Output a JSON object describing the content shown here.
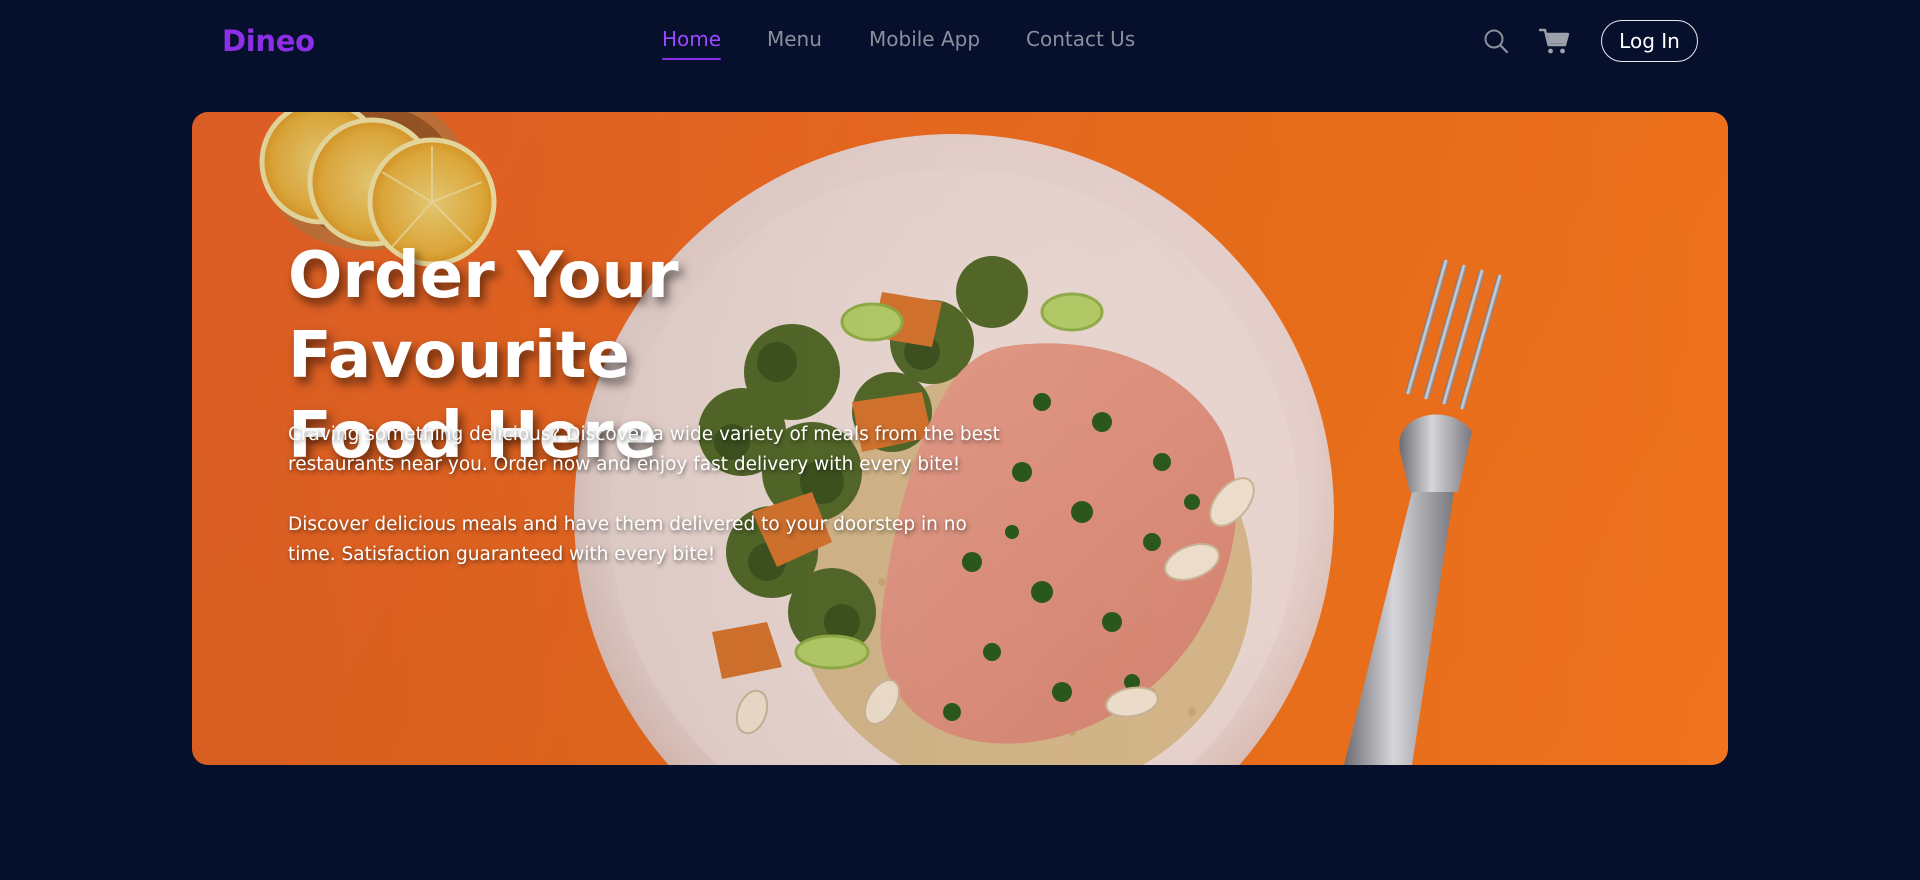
{
  "app": {
    "logo": "Dineo"
  },
  "nav": {
    "items": [
      {
        "label": "Home",
        "active": true
      },
      {
        "label": "Menu",
        "active": false
      },
      {
        "label": "Mobile App",
        "active": false
      },
      {
        "label": "Contact Us",
        "active": false
      }
    ]
  },
  "actions": {
    "search_icon": "search-icon",
    "cart_icon": "cart-icon",
    "login_label": "Log In"
  },
  "hero": {
    "title_line1": "Order Your Favourite",
    "title_line2": "Food Here",
    "paragraph1": "Craving something delicious? Discover a wide variety of meals from the best restaurants near you. Order now and enjoy fast delivery with every bite!",
    "paragraph2": "Discover delicious meals and have them delivered to your doorstep in no time. Satisfaction guaranteed with every bite!",
    "image_subject": "salmon-quinoa-plate-with-fork-and-lemons"
  },
  "colors": {
    "background": "#07102b",
    "brand": "#8d2fe6",
    "nav_text": "#8a8f9c",
    "hero_orange": "#ee6a21"
  }
}
